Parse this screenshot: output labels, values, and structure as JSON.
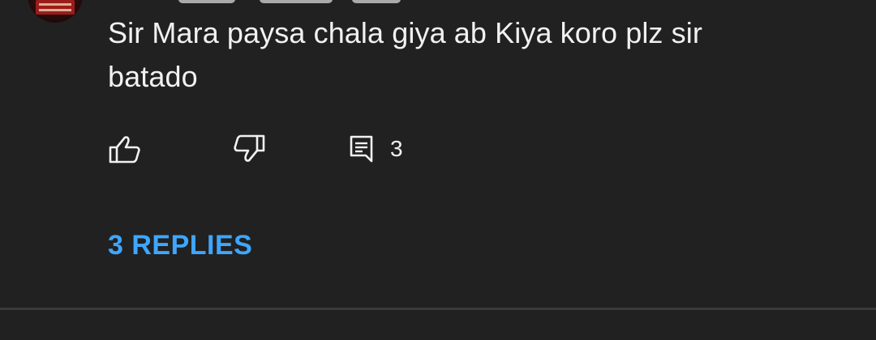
{
  "comment": {
    "text": "Sir Mara paysa chala giya ab Kiya koro plz sir batado"
  },
  "actions": {
    "like_icon": "thumb-up-outline",
    "dislike_icon": "thumb-down-outline",
    "reply_icon": "comment-outline",
    "reply_count": "3"
  },
  "replies": {
    "label": "3 REPLIES",
    "color": "#3ea6ff"
  },
  "theme": {
    "background": "#212121",
    "text": "#f1f1f1",
    "divider": "#3a3a3a"
  }
}
